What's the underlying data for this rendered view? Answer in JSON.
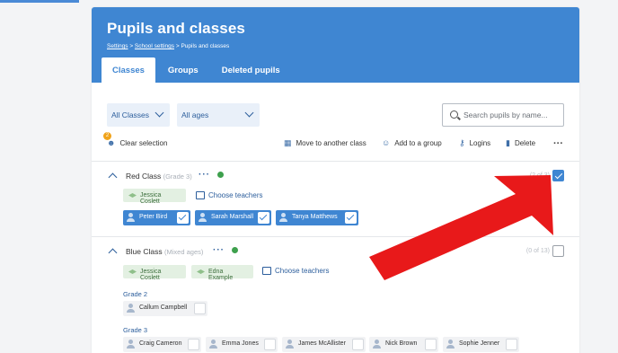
{
  "header": {
    "title": "Pupils and classes",
    "breadcrumb": [
      "Settings",
      "School settings",
      "Pupils and classes"
    ],
    "breadcrumb_sep": ">"
  },
  "tabs": [
    {
      "label": "Classes",
      "active": true
    },
    {
      "label": "Groups",
      "active": false
    },
    {
      "label": "Deleted pupils",
      "active": false
    }
  ],
  "filters": {
    "classes": "All Classes",
    "ages": "All ages",
    "search_placeholder": "Search pupils by name..."
  },
  "actions": {
    "selection_count": "2",
    "clear": "Clear selection",
    "move": "Move to another class",
    "add_group": "Add to a group",
    "logins": "Logins",
    "delete": "Delete"
  },
  "classes": [
    {
      "name": "Red Class",
      "grade": "(Grade 3)",
      "count": "(2 of 3)",
      "teachers": [
        "Jessica Coslett"
      ],
      "choose": "Choose teachers",
      "pupils": [
        "Peter Bird",
        "Sarah Marshall",
        "Tanya Matthews"
      ]
    },
    {
      "name": "Blue Class",
      "grade": "(Mixed ages)",
      "count": "(0 of 13)",
      "teachers": [
        "Jessica Coslett",
        "Edna Example"
      ],
      "choose": "Choose teachers",
      "groups": [
        {
          "label": "Grade 2",
          "pupils": [
            "Callum Campbell"
          ]
        },
        {
          "label": "Grade 3",
          "pupils": [
            "Craig Cameron",
            "Emma Jones",
            "James McAllister",
            "Nick Brown",
            "Sophie Jenner"
          ]
        }
      ]
    }
  ],
  "colors": {
    "brand": "#3f86d2",
    "annotation_arrow": "#e8191a",
    "ok": "#3ea04d"
  }
}
